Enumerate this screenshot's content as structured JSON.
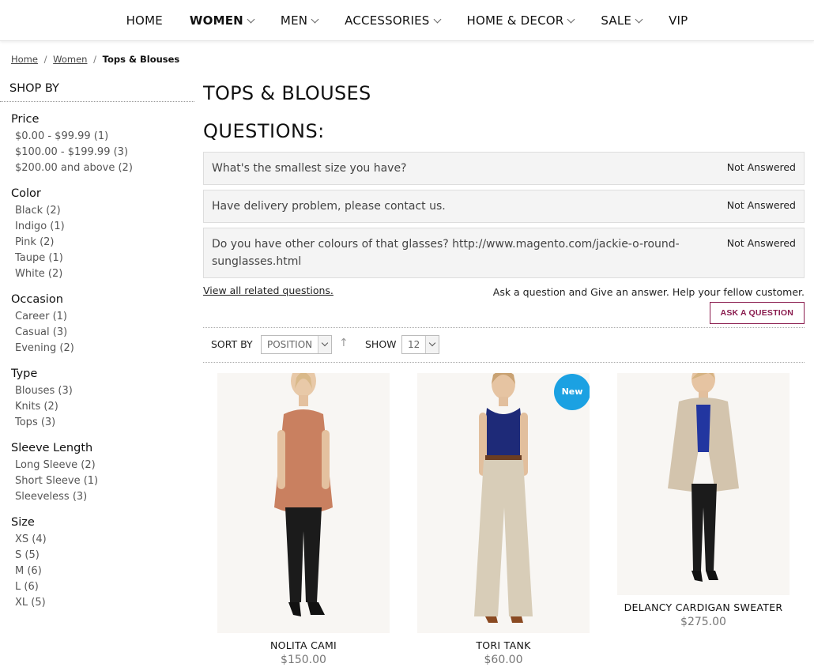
{
  "nav": {
    "items": [
      {
        "label": "HOME",
        "dropdown": false,
        "active": false
      },
      {
        "label": "WOMEN",
        "dropdown": true,
        "active": true
      },
      {
        "label": "MEN",
        "dropdown": true,
        "active": false
      },
      {
        "label": "ACCESSORIES",
        "dropdown": true,
        "active": false
      },
      {
        "label": "HOME & DECOR",
        "dropdown": true,
        "active": false
      },
      {
        "label": "SALE",
        "dropdown": true,
        "active": false
      },
      {
        "label": "VIP",
        "dropdown": false,
        "active": false
      }
    ]
  },
  "breadcrumb": {
    "home": "Home",
    "women": "Women",
    "current": "Tops & Blouses",
    "separator": "/"
  },
  "sidebar": {
    "heading": "SHOP BY",
    "groups": [
      {
        "title": "Price",
        "options": [
          "$0.00 - $99.99 (1)",
          "$100.00 - $199.99 (3)",
          "$200.00 and above (2)"
        ]
      },
      {
        "title": "Color",
        "options": [
          "Black (2)",
          "Indigo (1)",
          "Pink (2)",
          "Taupe (1)",
          "White (2)"
        ]
      },
      {
        "title": "Occasion",
        "options": [
          "Career (1)",
          "Casual (3)",
          "Evening (2)"
        ]
      },
      {
        "title": "Type",
        "options": [
          "Blouses (3)",
          "Knits (2)",
          "Tops (3)"
        ]
      },
      {
        "title": "Sleeve Length",
        "options": [
          "Long Sleeve (2)",
          "Short Sleeve (1)",
          "Sleeveless (3)"
        ]
      },
      {
        "title": "Size",
        "options": [
          "XS (4)",
          "S (5)",
          "M (6)",
          "L (6)",
          "XL (5)"
        ]
      }
    ]
  },
  "main": {
    "title": "TOPS & BLOUSES",
    "questions_heading": "QUESTIONS:",
    "questions": [
      {
        "text": "What's the smallest size you have?",
        "status": "Not Answered"
      },
      {
        "text": "Have delivery problem, please contact us.",
        "status": "Not Answered"
      },
      {
        "text": "Do you have other colours of that glasses? http://www.magento.com/jackie-o-round-sunglasses.html",
        "status": "Not Answered"
      }
    ],
    "view_all": "View all related questions.",
    "ask_prompt": "Ask a question and Give an answer. Help your fellow customer.",
    "ask_button": "ASK A QUESTION"
  },
  "toolbar": {
    "sort_label": "SORT BY",
    "sort_value": "POSITION",
    "sort_direction_glyph": "↑",
    "show_label": "SHOW",
    "show_value": "12"
  },
  "products": [
    {
      "name": "NOLITA CAMI",
      "price": "$150.00",
      "badge": "",
      "top_color": "#c98060",
      "bottom_color": "#1b1b1b"
    },
    {
      "name": "TORI TANK",
      "price": "$60.00",
      "badge": "New",
      "top_color": "#1e2a78",
      "bottom_color": "#d8cdb8"
    },
    {
      "name": "DELANCY CARDIGAN SWEATER",
      "price": "$275.00",
      "badge": "",
      "top_color": "#d3c4ad",
      "bottom_color": "#1b1b1b"
    }
  ],
  "colors": {
    "accent": "#8a1c4e",
    "badge": "#1ba1e2"
  }
}
